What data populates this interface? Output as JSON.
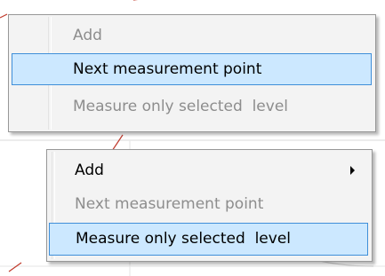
{
  "menu_top": {
    "items": [
      {
        "label": "Add",
        "enabled": false,
        "highlighted": false
      },
      {
        "label": "Next measurement point",
        "enabled": true,
        "highlighted": true
      },
      {
        "label": "Measure only selected  level",
        "enabled": false,
        "highlighted": false
      }
    ]
  },
  "menu_bottom": {
    "items": [
      {
        "label": "Add",
        "enabled": true,
        "highlighted": false,
        "has_submenu": true
      },
      {
        "label": "Next measurement point",
        "enabled": false,
        "highlighted": false
      },
      {
        "label": "Measure only selected  level",
        "enabled": true,
        "highlighted": true
      }
    ]
  },
  "colors": {
    "highlight_fill": "#cce8ff",
    "highlight_border": "#3f8fd9",
    "disabled_text": "#8d8d8d",
    "curve": "#c0392b"
  }
}
